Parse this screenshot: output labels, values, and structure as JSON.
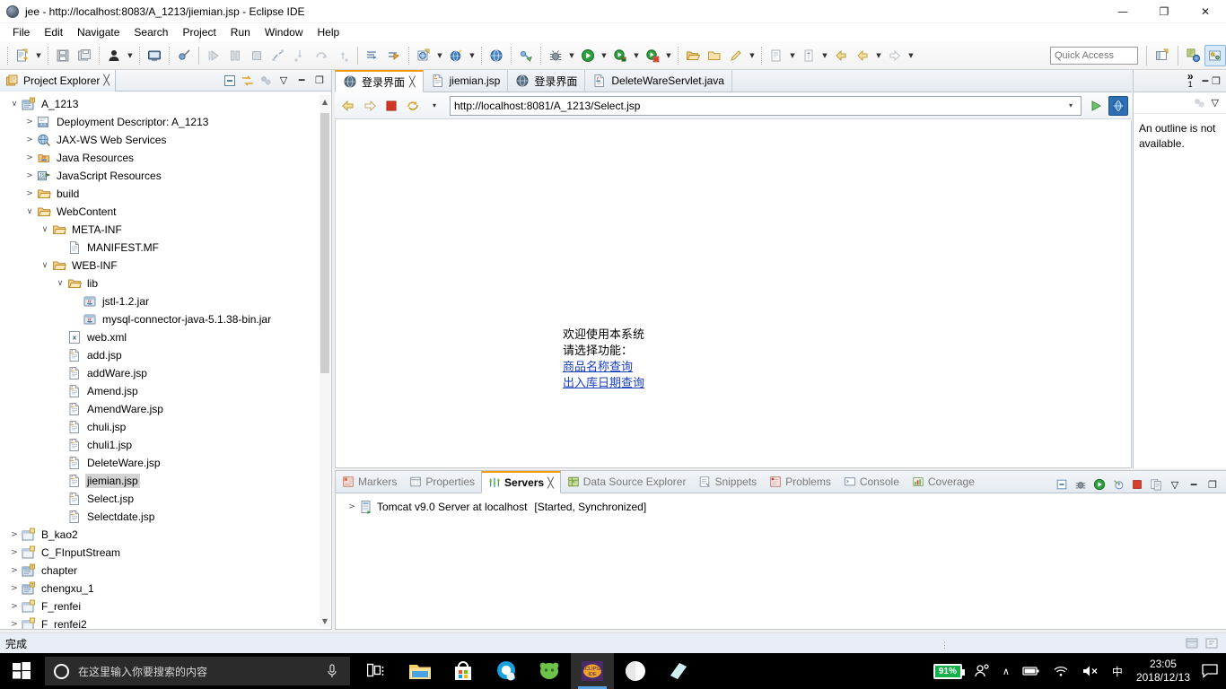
{
  "window": {
    "title": "jee - http://localhost:8083/A_1213/jiemian.jsp - Eclipse IDE",
    "minimize": "—",
    "maximize": "❐",
    "close": "✕"
  },
  "menubar": {
    "items": [
      "File",
      "Edit",
      "Navigate",
      "Search",
      "Project",
      "Run",
      "Window",
      "Help"
    ]
  },
  "toolbar": {
    "quick_access": "Quick Access"
  },
  "project_explorer": {
    "title": "Project Explorer",
    "close_glyph": "╳",
    "tree": [
      {
        "label": "A_1213",
        "indent": 0,
        "twist": "v",
        "icon": "project",
        "selected": false
      },
      {
        "label": "Deployment Descriptor: A_1213",
        "indent": 1,
        "twist": ">",
        "icon": "deployment",
        "selected": false
      },
      {
        "label": "JAX-WS Web Services",
        "indent": 1,
        "twist": ">",
        "icon": "jaxws",
        "selected": false
      },
      {
        "label": "Java Resources",
        "indent": 1,
        "twist": ">",
        "icon": "javares",
        "selected": false
      },
      {
        "label": "JavaScript Resources",
        "indent": 1,
        "twist": ">",
        "icon": "jsres",
        "selected": false
      },
      {
        "label": "build",
        "indent": 1,
        "twist": ">",
        "icon": "folder",
        "selected": false
      },
      {
        "label": "WebContent",
        "indent": 1,
        "twist": "v",
        "icon": "folder",
        "selected": false
      },
      {
        "label": "META-INF",
        "indent": 2,
        "twist": "v",
        "icon": "folder",
        "selected": false
      },
      {
        "label": "MANIFEST.MF",
        "indent": 3,
        "twist": "",
        "icon": "file",
        "selected": false
      },
      {
        "label": "WEB-INF",
        "indent": 2,
        "twist": "v",
        "icon": "folder",
        "selected": false
      },
      {
        "label": "lib",
        "indent": 3,
        "twist": "v",
        "icon": "folder",
        "selected": false
      },
      {
        "label": "jstl-1.2.jar",
        "indent": 4,
        "twist": "",
        "icon": "jar",
        "selected": false
      },
      {
        "label": "mysql-connector-java-5.1.38-bin.jar",
        "indent": 4,
        "twist": "",
        "icon": "jar",
        "selected": false
      },
      {
        "label": "web.xml",
        "indent": 3,
        "twist": "",
        "icon": "xml",
        "selected": false
      },
      {
        "label": "add.jsp",
        "indent": 3,
        "twist": "",
        "icon": "jsp",
        "selected": false
      },
      {
        "label": "addWare.jsp",
        "indent": 3,
        "twist": "",
        "icon": "jsp",
        "selected": false
      },
      {
        "label": "Amend.jsp",
        "indent": 3,
        "twist": "",
        "icon": "jsp",
        "selected": false
      },
      {
        "label": "AmendWare.jsp",
        "indent": 3,
        "twist": "",
        "icon": "jsp",
        "selected": false
      },
      {
        "label": "chuli.jsp",
        "indent": 3,
        "twist": "",
        "icon": "jsp",
        "selected": false
      },
      {
        "label": "chuli1.jsp",
        "indent": 3,
        "twist": "",
        "icon": "jsp",
        "selected": false
      },
      {
        "label": "DeleteWare.jsp",
        "indent": 3,
        "twist": "",
        "icon": "jsp",
        "selected": false
      },
      {
        "label": "jiemian.jsp",
        "indent": 3,
        "twist": "",
        "icon": "jsp",
        "selected": true
      },
      {
        "label": "Select.jsp",
        "indent": 3,
        "twist": "",
        "icon": "jsp",
        "selected": false
      },
      {
        "label": "Selectdate.jsp",
        "indent": 3,
        "twist": "",
        "icon": "jsp",
        "selected": false
      },
      {
        "label": "B_kao2",
        "indent": 0,
        "twist": ">",
        "icon": "project-closed",
        "selected": false
      },
      {
        "label": "C_FInputStream",
        "indent": 0,
        "twist": ">",
        "icon": "project-closed",
        "selected": false
      },
      {
        "label": "chapter",
        "indent": 0,
        "twist": ">",
        "icon": "project",
        "selected": false
      },
      {
        "label": "chengxu_1",
        "indent": 0,
        "twist": ">",
        "icon": "project",
        "selected": false
      },
      {
        "label": "F_renfei",
        "indent": 0,
        "twist": ">",
        "icon": "project-closed",
        "selected": false
      },
      {
        "label": "F_renfei2",
        "indent": 0,
        "twist": ">",
        "icon": "project-closed",
        "selected": false
      }
    ]
  },
  "editor": {
    "tabs": [
      {
        "label": "登录界面",
        "icon": "globe",
        "active": true,
        "close": "╳"
      },
      {
        "label": "jiemian.jsp",
        "icon": "jsp",
        "active": false,
        "close": ""
      },
      {
        "label": "登录界面",
        "icon": "globe",
        "active": false,
        "close": ""
      },
      {
        "label": "DeleteWareServlet.java",
        "icon": "java",
        "active": false,
        "close": ""
      }
    ],
    "browser": {
      "url": "http://localhost:8081/A_1213/Select.jsp",
      "back_icon": "back-arrow-icon",
      "forward_icon": "forward-arrow-icon",
      "stop_icon": "stop-icon",
      "refresh_icon": "refresh-icon",
      "dropdown_caret": "▾",
      "url_caret": "▾",
      "go_icon": "go-icon",
      "open_external_icon": "open-external-browser-icon"
    },
    "page": {
      "line1": "欢迎使用本系统",
      "line2": "请选择功能：",
      "link1": "商品名称查询",
      "link2": "出入库日期查询",
      "link_color": "#1a3fbf"
    }
  },
  "outline": {
    "overflow_glyph": "»",
    "overflow_count": "1",
    "minimize_glyph": "━",
    "maximize_glyph": "❐",
    "menu_glyph": "▽",
    "message": "An outline is not available."
  },
  "bottom_panel": {
    "tabs": [
      {
        "label": "Markers",
        "active": false,
        "close": ""
      },
      {
        "label": "Properties",
        "active": false,
        "close": ""
      },
      {
        "label": "Servers",
        "active": true,
        "close": "╳"
      },
      {
        "label": "Data Source Explorer",
        "active": false,
        "close": ""
      },
      {
        "label": "Snippets",
        "active": false,
        "close": ""
      },
      {
        "label": "Problems",
        "active": false,
        "close": ""
      },
      {
        "label": "Console",
        "active": false,
        "close": ""
      },
      {
        "label": "Coverage",
        "active": false,
        "close": ""
      }
    ],
    "server_row": {
      "twist": ">",
      "name": "Tomcat v9.0 Server at localhost",
      "status": "[Started, Synchronized]"
    },
    "menu_glyph": "▽",
    "minimize_glyph": "━",
    "maximize_glyph": "❐"
  },
  "statusbar": {
    "message": "完成",
    "dots": "⋮"
  },
  "taskbar": {
    "search_placeholder": "在这里输入你要搜索的内容",
    "battery_percent": "91%",
    "time": "23:05",
    "date": "2018/12/13",
    "ime": "中",
    "tray_chevron": "∧",
    "apps": [
      {
        "name": "task-view",
        "active": false
      },
      {
        "name": "file-explorer",
        "active": false
      },
      {
        "name": "microsoft-store",
        "active": false
      },
      {
        "name": "browser-qq",
        "active": false
      },
      {
        "name": "app-green",
        "active": false
      },
      {
        "name": "eclipse-ide",
        "active": true
      },
      {
        "name": "app-white",
        "active": false
      },
      {
        "name": "app-teal",
        "active": false
      }
    ]
  }
}
